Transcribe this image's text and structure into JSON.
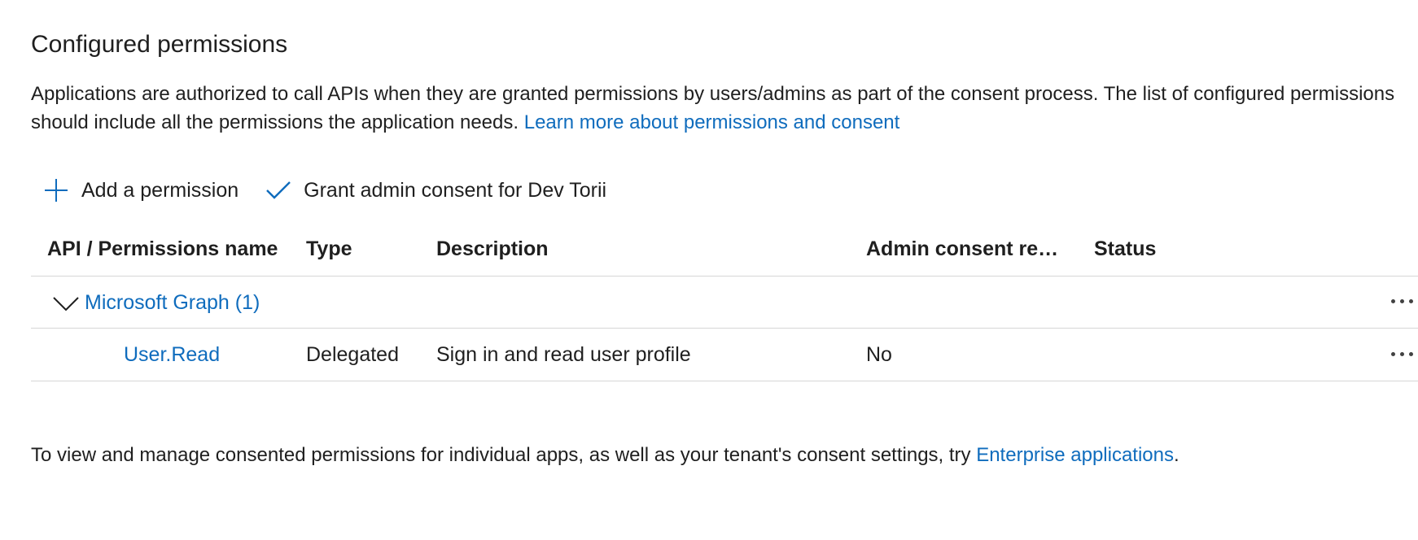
{
  "section": {
    "title": "Configured permissions",
    "description": "Applications are authorized to call APIs when they are granted permissions by users/admins as part of the consent process. The list of configured permissions should include all the permissions the application needs.",
    "learn_more_link": "Learn more about permissions and consent"
  },
  "toolbar": {
    "add_permission_label": "Add a permission",
    "add_icon": "plus-icon",
    "grant_consent_label": "Grant admin consent for Dev Torii",
    "grant_icon": "checkmark-icon"
  },
  "table": {
    "columns": {
      "name": "API / Permissions name",
      "type": "Type",
      "description": "Description",
      "admin_consent": "Admin consent req...",
      "status": "Status"
    },
    "groups": [
      {
        "label": "Microsoft Graph (1)",
        "expanded": true,
        "items": [
          {
            "name": "User.Read",
            "type": "Delegated",
            "description": "Sign in and read user profile",
            "admin_consent": "No",
            "status": ""
          }
        ]
      }
    ]
  },
  "footer": {
    "text": "To view and manage consented permissions for individual apps, as well as your tenant's consent settings, try ",
    "link": "Enterprise applications",
    "suffix": "."
  },
  "colors": {
    "link": "#0f6cbd",
    "text": "#1f1f1f",
    "divider": "#d6d6d6"
  }
}
